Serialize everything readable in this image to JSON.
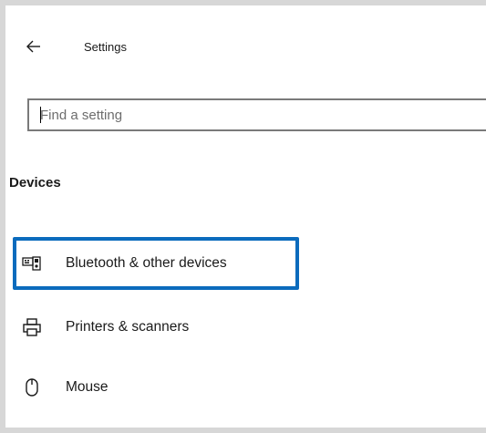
{
  "header": {
    "back_icon": "back-arrow-icon",
    "title": "Settings"
  },
  "search": {
    "placeholder": "Find a setting",
    "value": ""
  },
  "section": {
    "heading": "Devices"
  },
  "nav": {
    "items": [
      {
        "label": "Bluetooth & other devices",
        "icon": "bluetooth-devices-icon",
        "highlighted": true
      },
      {
        "label": "Printers & scanners",
        "icon": "printer-icon",
        "highlighted": false
      },
      {
        "label": "Mouse",
        "icon": "mouse-icon",
        "highlighted": false
      }
    ]
  },
  "colors": {
    "highlight_border": "#0b6bbd",
    "background": "#ffffff",
    "frame": "#d7d7d7"
  }
}
